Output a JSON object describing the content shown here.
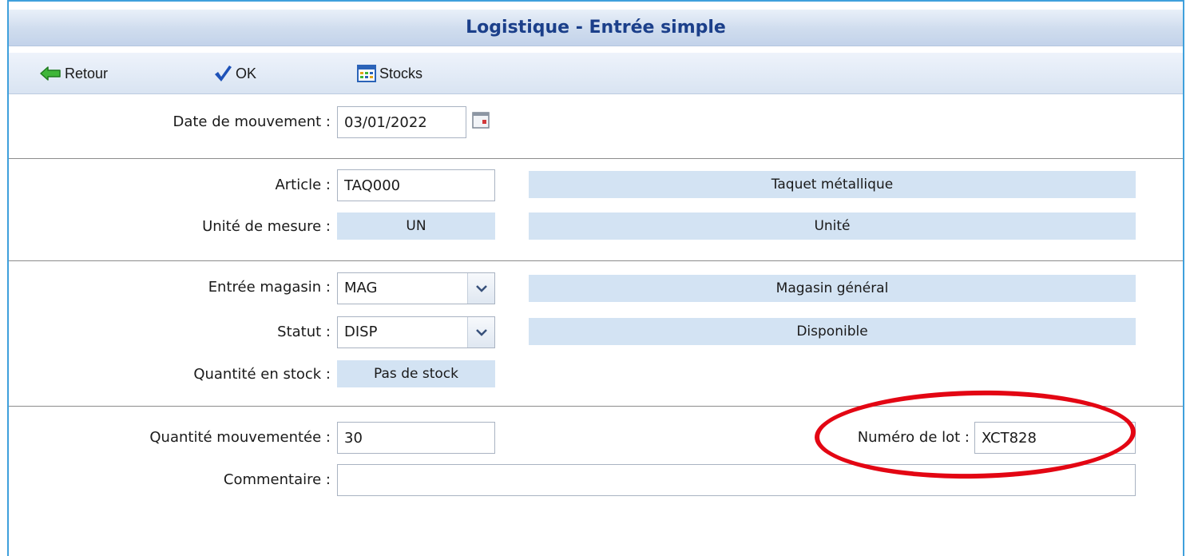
{
  "window": {
    "title": "Logistique - Entrée simple"
  },
  "toolbar": {
    "back_label": "Retour",
    "ok_label": "OK",
    "stocks_label": "Stocks",
    "back_icon": "arrow-left-icon",
    "ok_icon": "checkmark-icon",
    "stocks_icon": "grid-table-icon"
  },
  "form": {
    "date": {
      "label": "Date de mouvement :",
      "value": "03/01/2022",
      "icon": "calendar-icon"
    },
    "article": {
      "label": "Article :",
      "value": "TAQ000",
      "description": "Taquet métallique"
    },
    "unit": {
      "label": "Unité de mesure :",
      "code": "UN",
      "description": "Unité"
    },
    "store": {
      "label": "Entrée magasin :",
      "value": "MAG",
      "description": "Magasin général"
    },
    "status": {
      "label": "Statut :",
      "value": "DISP",
      "description": "Disponible"
    },
    "stock_qty": {
      "label": "Quantité en stock :",
      "value": "Pas de stock"
    },
    "moved_qty": {
      "label": "Quantité mouvementée :",
      "value": "30"
    },
    "lot": {
      "label": "Numéro de lot :",
      "value": "XCT828"
    },
    "comment": {
      "label": "Commentaire :",
      "value": ""
    }
  },
  "colors": {
    "title_text": "#1b3f8a",
    "frame_border": "#3fa0dc",
    "readonly_bg": "#d3e3f3",
    "highlight_ring": "#e30613"
  }
}
